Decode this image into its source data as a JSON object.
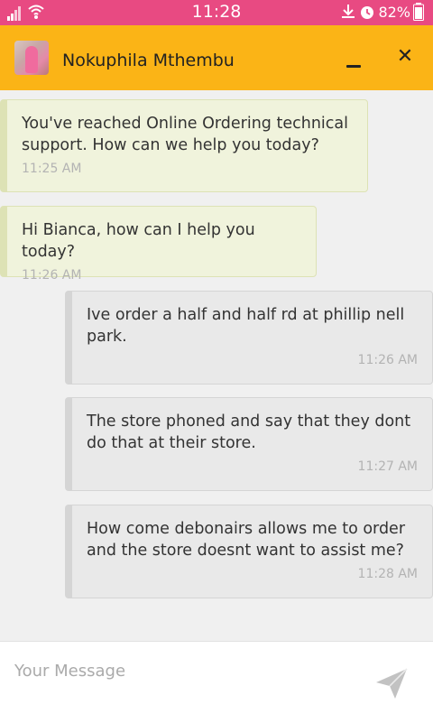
{
  "status_bar": {
    "time": "11:28",
    "battery": "82%",
    "color": "#e84a82"
  },
  "header": {
    "contact_name": "Nokuphila Mthembu",
    "minimize_icon": "minimize-icon",
    "close_label": "✕",
    "color": "#fbb416"
  },
  "messages": [
    {
      "direction": "in",
      "text": "You've reached Online Ordering technical support. How can we help you today?",
      "time": "11:25 AM"
    },
    {
      "direction": "in",
      "text": "Hi Bianca, how can I help you today?",
      "time": "11:26 AM"
    },
    {
      "direction": "out",
      "text": "Ive order a half and half rd at phillip nell park.",
      "time": "11:26 AM"
    },
    {
      "direction": "out",
      "text": "The store phoned and say that they dont do that at their store.",
      "time": "11:27 AM"
    },
    {
      "direction": "out",
      "text": "How come debonairs allows me to order and the store doesnt want to assist me?",
      "time": "11:28 AM"
    }
  ],
  "composer": {
    "placeholder": "Your Message",
    "value": "",
    "send_icon": "send-icon"
  }
}
